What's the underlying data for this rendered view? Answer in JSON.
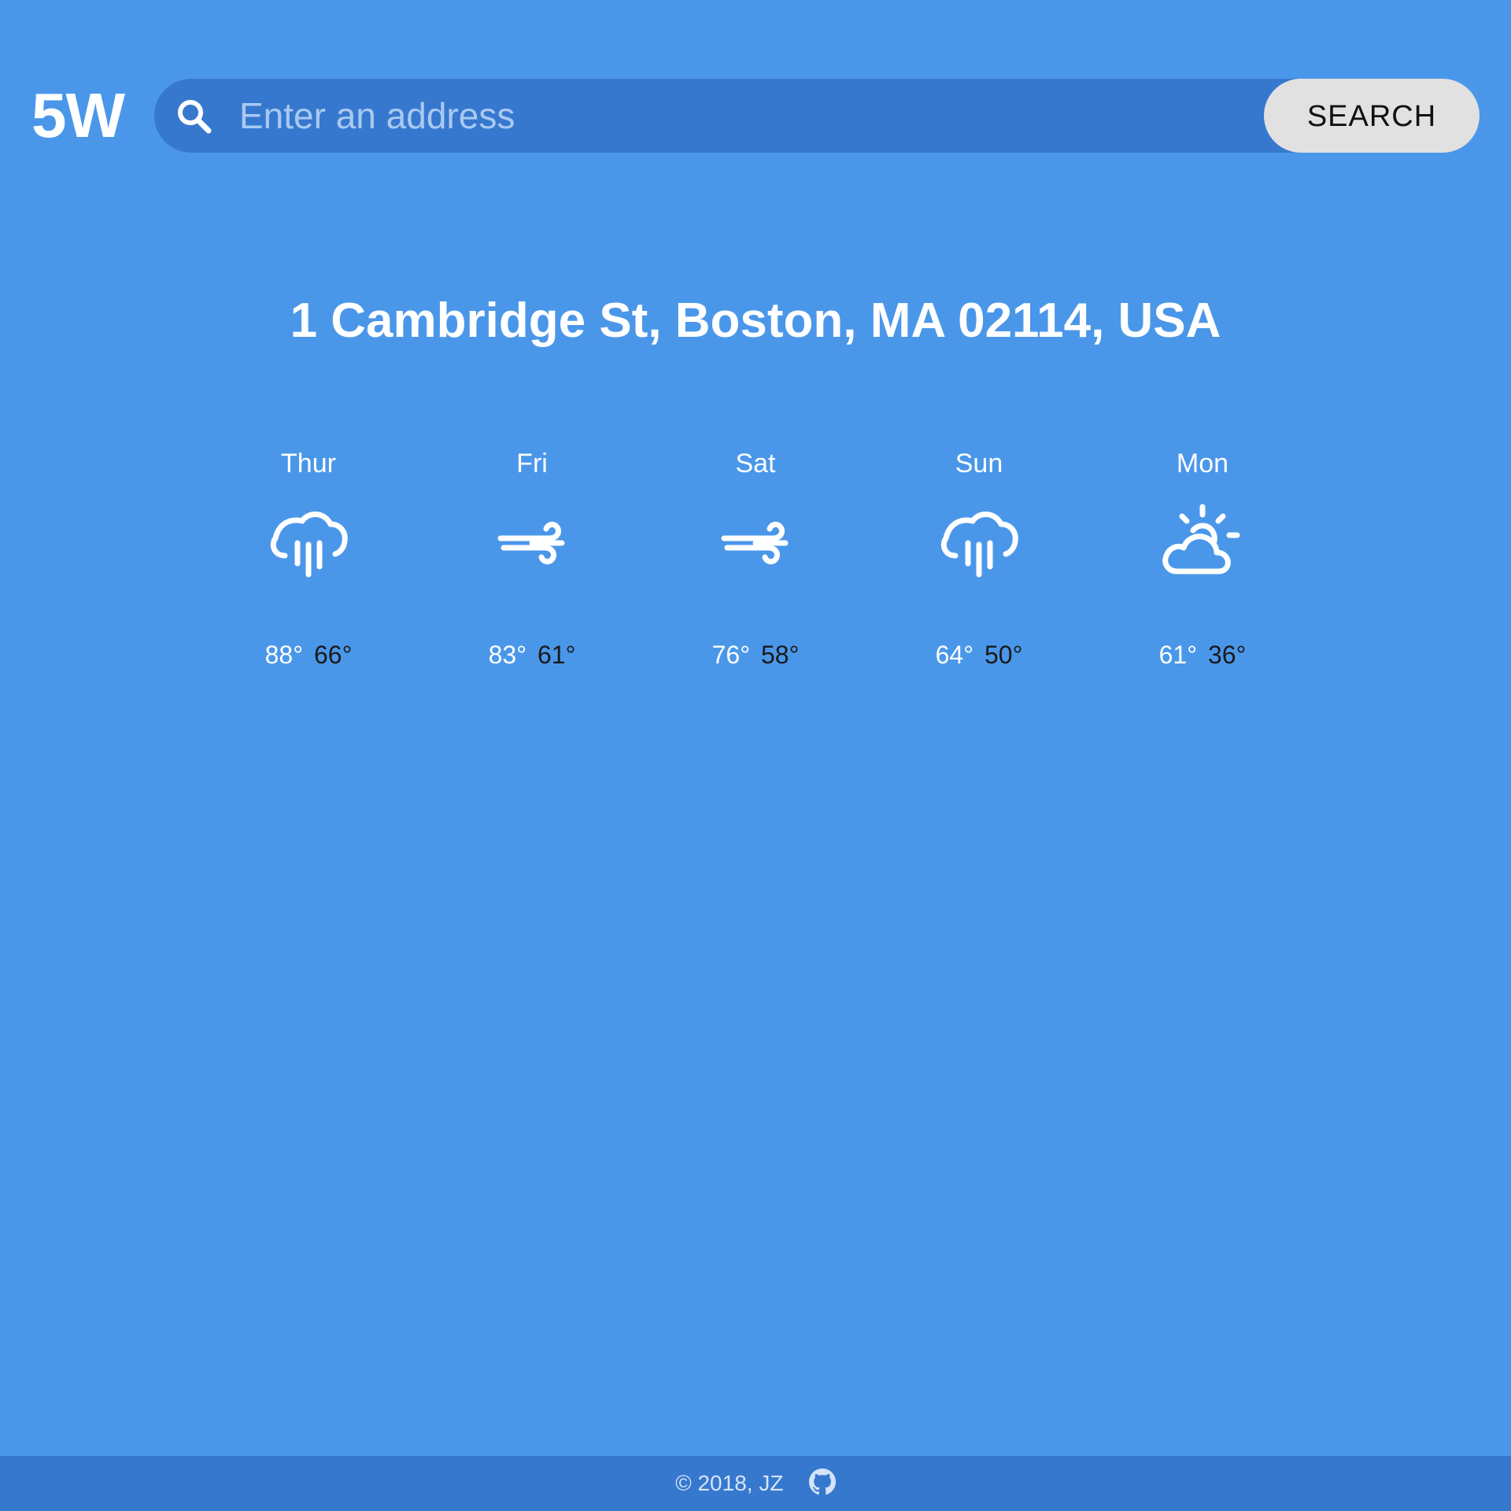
{
  "app": {
    "logo": "5W"
  },
  "search": {
    "icon": "search-icon",
    "placeholder": "Enter an address",
    "value": "",
    "button_label": "SEARCH"
  },
  "location": "1 Cambridge St, Boston, MA 02114, USA",
  "forecast": [
    {
      "day": "Thur",
      "icon": "rain-icon",
      "high": "88°",
      "low": "66°"
    },
    {
      "day": "Fri",
      "icon": "wind-icon",
      "high": "83°",
      "low": "61°"
    },
    {
      "day": "Sat",
      "icon": "wind-icon",
      "high": "76°",
      "low": "58°"
    },
    {
      "day": "Sun",
      "icon": "rain-icon",
      "high": "64°",
      "low": "50°"
    },
    {
      "day": "Mon",
      "icon": "partly-cloudy-icon",
      "high": "61°",
      "low": "36°"
    }
  ],
  "footer": {
    "text": "© 2018, JZ",
    "icon": "github-icon"
  },
  "colors": {
    "background": "#4a97ea",
    "search_bar": "#3778cf",
    "button": "#e1e1e1",
    "footer": "#3778cf"
  }
}
